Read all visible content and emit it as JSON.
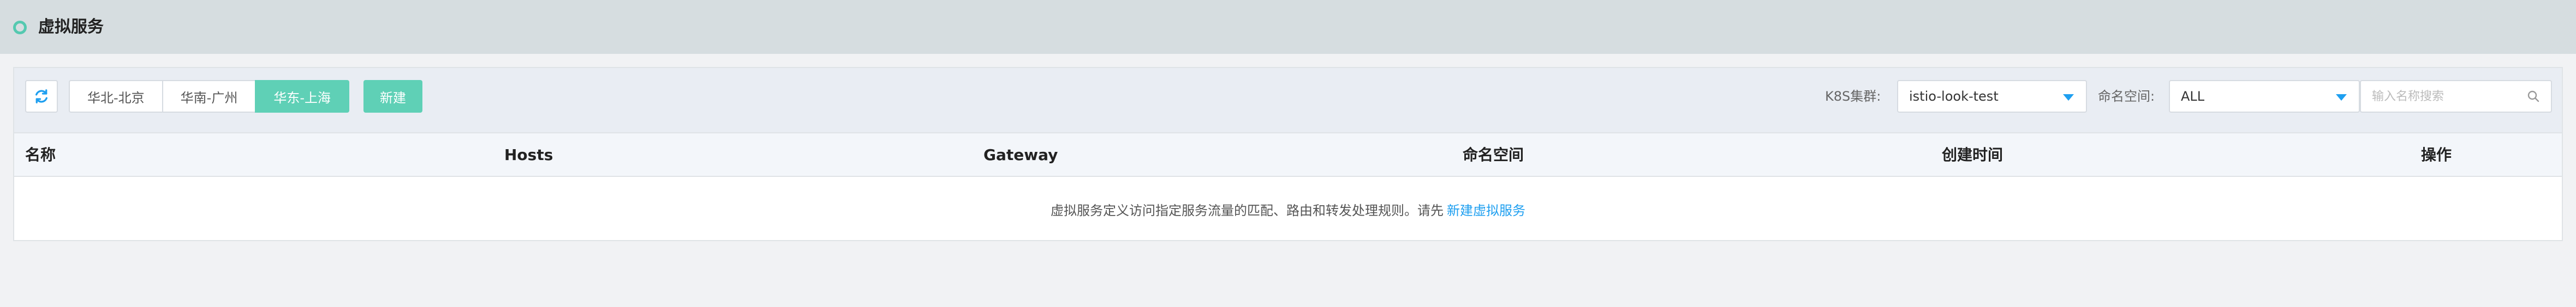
{
  "header": {
    "title": "虚拟服务"
  },
  "toolbar": {
    "refresh_icon": "refresh-icon",
    "regions": [
      {
        "label": "华北-北京",
        "active": false
      },
      {
        "label": "华南-广州",
        "active": false
      },
      {
        "label": "华东-上海",
        "active": true
      }
    ],
    "create_label": "新建",
    "cluster_label": "K8S集群:",
    "cluster_value": "istio-look-test",
    "namespace_label": "命名空间:",
    "namespace_value": "ALL",
    "search_placeholder": "输入名称搜索"
  },
  "table": {
    "columns": [
      "名称",
      "Hosts",
      "Gateway",
      "命名空间",
      "创建时间",
      "操作"
    ],
    "empty_text": "虚拟服务定义访问指定服务流量的匹配、路由和转发处理规则。请先",
    "empty_link": "新建虚拟服务"
  },
  "colors": {
    "accent": "#5fd0b6",
    "link": "#1e9ff0",
    "header_bg": "#d6dde0",
    "toolbar_bg": "#e9edf3"
  }
}
